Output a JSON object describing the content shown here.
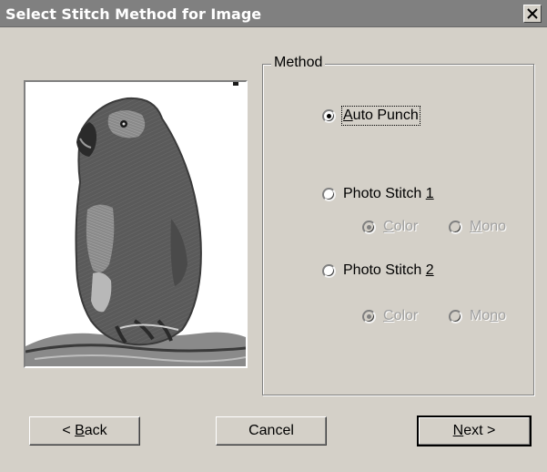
{
  "window": {
    "title": "Select Stitch Method for Image",
    "close_glyph": "×"
  },
  "group": {
    "legend": "Method"
  },
  "options": {
    "auto_punch": {
      "pre": "",
      "mn": "A",
      "post": "uto Punch",
      "selected": true,
      "enabled": true
    },
    "photo1": {
      "pre": "Photo Stitch ",
      "mn": "1",
      "post": "",
      "selected": false,
      "enabled": true
    },
    "photo1_color": {
      "pre": "",
      "mn": "C",
      "post": "olor",
      "selected": true,
      "enabled": false
    },
    "photo1_mono": {
      "pre": "",
      "mn": "M",
      "post": "ono",
      "selected": false,
      "enabled": false
    },
    "photo2": {
      "pre": "Photo Stitch ",
      "mn": "2",
      "post": "",
      "selected": false,
      "enabled": true
    },
    "photo2_color": {
      "pre": "",
      "mn": "C",
      "post": "olor",
      "selected": true,
      "enabled": false
    },
    "photo2_mono": {
      "pre": "Mo",
      "mn": "n",
      "post": "o",
      "selected": false,
      "enabled": false
    }
  },
  "buttons": {
    "back": {
      "pre": "< ",
      "mn": "B",
      "post": "ack"
    },
    "cancel": {
      "label": "Cancel"
    },
    "next": {
      "pre": "",
      "mn": "N",
      "post": "ext >"
    }
  },
  "colors": {
    "dialog_bg": "#d4d0c8",
    "titlebar_bg": "#808080",
    "title_text": "#ffffff",
    "disabled_text": "#a0a0a0"
  },
  "icons": {
    "preview": "parrot-embroidery-image"
  }
}
